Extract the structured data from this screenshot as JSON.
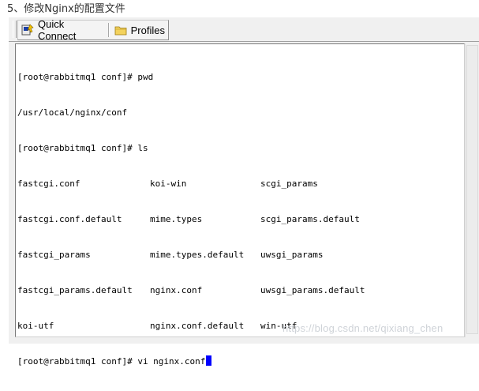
{
  "heading": "5、修改Nginx的配置文件",
  "toolbar": {
    "quick_connect_label": "Quick Connect",
    "quick_connect_icon": "quick-connect-icon",
    "profiles_label": "Profiles",
    "profiles_icon": "folder-icon"
  },
  "terminal": {
    "prompt_pwd": "[root@rabbitmq1 conf]# pwd",
    "pwd_output": "/usr/local/nginx/conf",
    "prompt_ls": "[root@rabbitmq1 conf]# ls",
    "ls_rows": [
      [
        "fastcgi.conf",
        "koi-win",
        "scgi_params"
      ],
      [
        "fastcgi.conf.default",
        "mime.types",
        "scgi_params.default"
      ],
      [
        "fastcgi_params",
        "mime.types.default",
        "uwsgi_params"
      ],
      [
        "fastcgi_params.default",
        "nginx.conf",
        "uwsgi_params.default"
      ],
      [
        "koi-utf",
        "nginx.conf.default",
        "win-utf"
      ]
    ],
    "prompt_vi": "[root@rabbitmq1 conf]# vi nginx.conf"
  },
  "watermark": "https://blog.csdn.net/qixiang_chen",
  "colors": {
    "cursor": "#0000ff",
    "terminal_bg": "#ffffff",
    "window_bg": "#f0f0f0"
  }
}
